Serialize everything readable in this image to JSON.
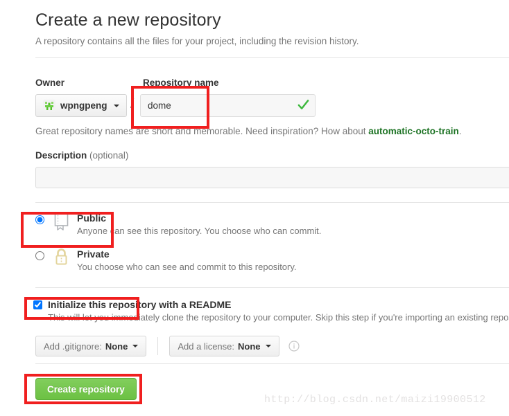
{
  "header": {
    "title": "Create a new repository",
    "subtitle": "A repository contains all the files for your project, including the revision history."
  },
  "owner": {
    "label": "Owner",
    "name": "wpngpeng",
    "avatar_icon": "identicon-avatar-icon",
    "caret_icon": "caret-down-icon"
  },
  "repository_name": {
    "label": "Repository name",
    "separator": "/",
    "value": "dome",
    "placeholder": "",
    "valid_icon": "check-icon"
  },
  "name_hint": {
    "prefix": "Great repository names are short and memorable. Need inspiration? How about ",
    "suggestion": "automatic-octo-train",
    "suffix": "."
  },
  "description": {
    "label": "Description",
    "optional": "(optional)",
    "value": "",
    "placeholder": ""
  },
  "visibility": {
    "options": [
      {
        "id": "public",
        "title": "Public",
        "description": "Anyone can see this repository. You choose who can commit.",
        "icon": "repo-book-icon",
        "selected": true
      },
      {
        "id": "private",
        "title": "Private",
        "description": "You choose who can see and commit to this repository.",
        "icon": "lock-icon",
        "selected": false
      }
    ]
  },
  "readme": {
    "title": "Initialize this repository with a README",
    "description": "This will let you immediately clone the repository to your computer. Skip this step if you're importing an existing repository.",
    "checked": true
  },
  "gitignore": {
    "label": "Add .gitignore:",
    "value": "None",
    "caret_icon": "caret-down-icon"
  },
  "license": {
    "label": "Add a license:",
    "value": "None",
    "caret_icon": "caret-down-icon",
    "info_icon": "info-circle-icon"
  },
  "submit": {
    "label": "Create repository"
  },
  "watermark": {
    "text": "http://blog.csdn.net/maizi19900512"
  },
  "colors": {
    "accent_green": "#6cc143",
    "suggestion_green": "#1d7324",
    "annotation_red": "#f01f1f",
    "muted_text": "#767676",
    "lock_gold": "#e8d9a0"
  }
}
